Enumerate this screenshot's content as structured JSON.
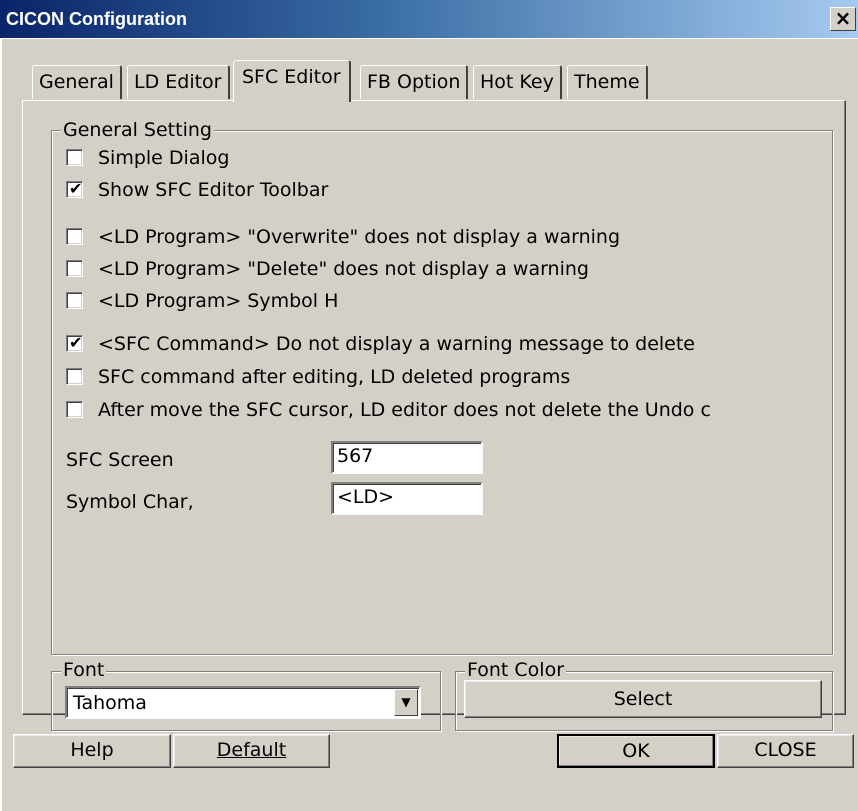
{
  "window": {
    "title": "CICON Configuration",
    "close_glyph": "×"
  },
  "tabs": [
    {
      "label": "General"
    },
    {
      "label": "LD Editor"
    },
    {
      "label": "SFC Editor",
      "active": true
    },
    {
      "label": "FB Option"
    },
    {
      "label": "Hot Key"
    },
    {
      "label": "Theme"
    }
  ],
  "general_setting": {
    "title": "General Setting",
    "checkboxes": [
      {
        "label": "Simple Dialog",
        "checked": false
      },
      {
        "label": "Show SFC Editor Toolbar",
        "checked": true
      },
      {
        "label": "<LD Program> \"Overwrite\" does not display a warning",
        "checked": false
      },
      {
        "label": "<LD Program> \"Delete\" does not display a warning",
        "checked": false
      },
      {
        "label": "<LD Program> Symbol H",
        "checked": false
      },
      {
        "label": "<SFC Command> Do not display a warning message to delete",
        "checked": true
      },
      {
        "label": "SFC command after editing, LD deleted programs",
        "checked": false
      },
      {
        "label": "After move the SFC cursor, LD editor does not delete the Undo c",
        "checked": false
      }
    ],
    "sfc_screen": {
      "label": "SFC Screen",
      "value": "567"
    },
    "symbol_char": {
      "label": "Symbol Char,",
      "value": "<LD>"
    }
  },
  "font_group": {
    "title": "Font",
    "selected": "Tahoma",
    "arrow_glyph": "▼"
  },
  "font_color_group": {
    "title": "Font Color",
    "select_label": "Select"
  },
  "buttons": {
    "help": "Help",
    "default": "Default",
    "ok": "OK",
    "close": "CLOSE"
  },
  "check_glyph": "✔"
}
